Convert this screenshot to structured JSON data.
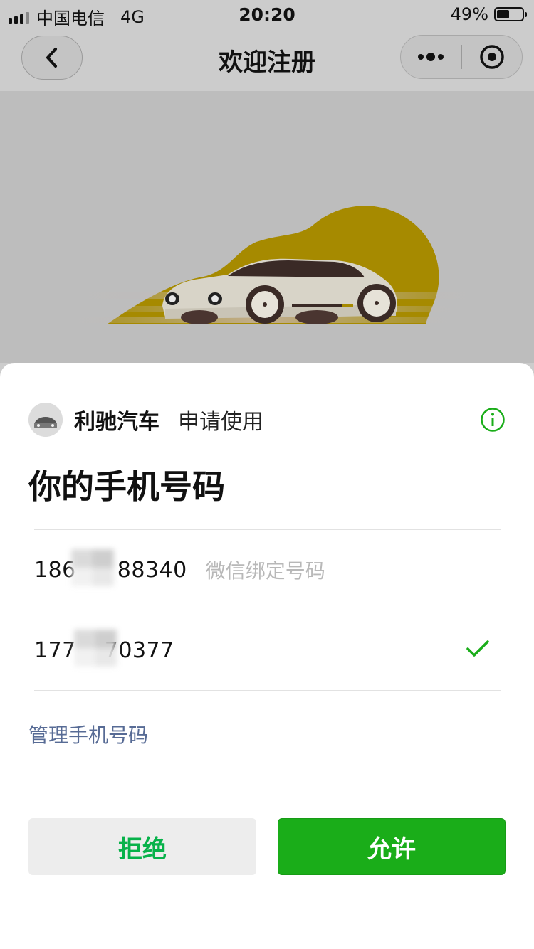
{
  "status_bar": {
    "carrier": "中国电信",
    "network": "4G",
    "time": "20:20",
    "battery_text": "49%",
    "battery_level": 0.49
  },
  "nav": {
    "title": "欢迎注册",
    "back_icon": "chevron-left-icon",
    "more_icon": "more-dots-icon",
    "close_icon": "target-circle-icon"
  },
  "sheet": {
    "app_name": "利驰汽车",
    "request_text": "申请使用",
    "info_icon": "info-icon",
    "title": "你的手机号码",
    "phones": [
      {
        "prefix": "186",
        "suffix": "88340",
        "note": "微信绑定号码",
        "selected": false
      },
      {
        "prefix": "177",
        "suffix": "70377",
        "note": "",
        "selected": true
      }
    ],
    "manage_link": "管理手机号码",
    "reject_label": "拒绝",
    "allow_label": "允许"
  },
  "colors": {
    "accent_green": "#1aad19",
    "reject_text": "#07b24a",
    "link_blue": "#576b95",
    "hero_yellow": "#a68a00"
  }
}
